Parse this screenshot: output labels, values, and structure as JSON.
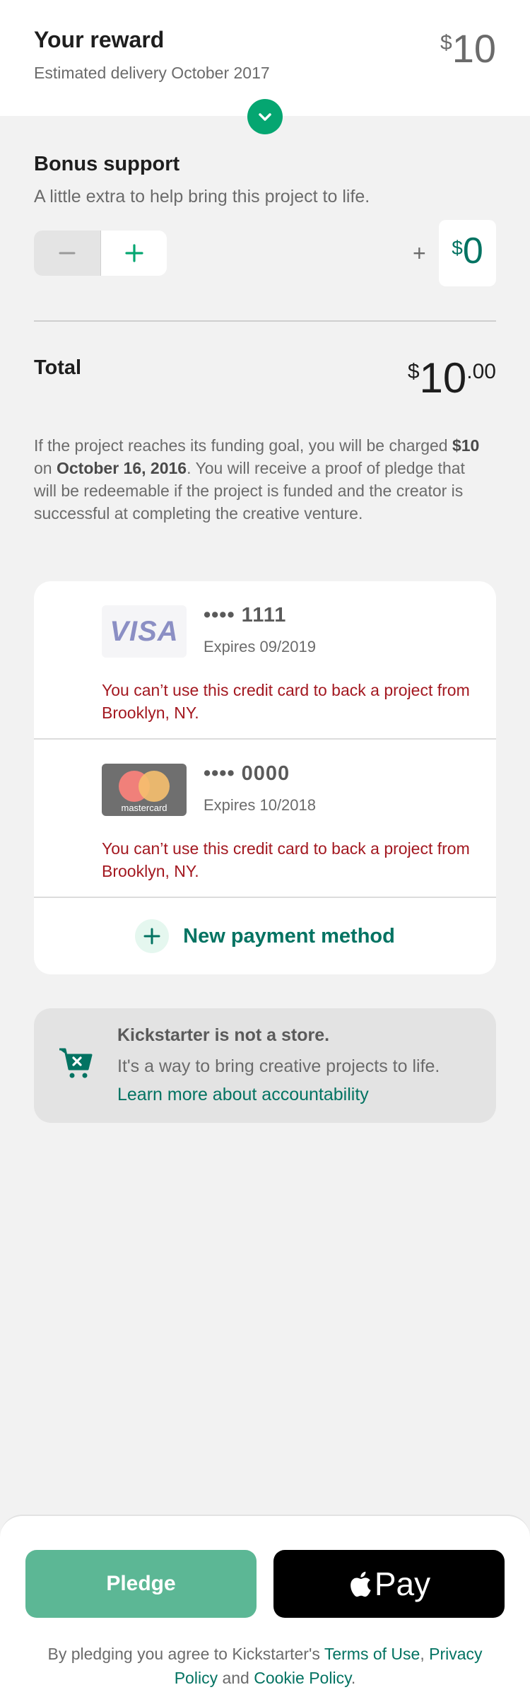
{
  "reward": {
    "title": "Your reward",
    "delivery": "Estimated delivery October 2017",
    "currency": "$",
    "amount": "10"
  },
  "bonus": {
    "title": "Bonus support",
    "subtitle": "A little extra to help bring this project to life.",
    "plus_sign": "+",
    "currency": "$",
    "value": "0"
  },
  "total": {
    "label": "Total",
    "currency": "$",
    "amount": "10",
    "cents": ".00"
  },
  "notice": {
    "part1": "If the project reaches its funding goal, you will be charged ",
    "amount": "$10",
    "part2": " on ",
    "date": "October 16, 2016",
    "part3": ". You will receive a proof of pledge that will be redeemable if the project is funded and the creator is successful at completing the creative venture."
  },
  "cards": [
    {
      "brand": "VISA",
      "number": "•••• 1111",
      "expires": "Expires 09/2019",
      "error": "You can’t use this credit card to back a project from Brooklyn, NY."
    },
    {
      "brand": "mastercard",
      "number": "•••• 0000",
      "expires": "Expires 10/2018",
      "error": "You can’t use this credit card to back a project from Brooklyn, NY."
    }
  ],
  "new_payment_label": "New payment method",
  "store_notice": {
    "title": "Kickstarter is not a store.",
    "body": "It's a way to bring creative projects to life. ",
    "link": "Learn more about accountability"
  },
  "actions": {
    "pledge_label": "Pledge",
    "applepay_label": "Pay"
  },
  "terms": {
    "prefix": "By pledging you agree to Kickstarter's ",
    "terms_link": "Terms of Use",
    "sep": ", ",
    "privacy_link": "Privacy Policy",
    "and": " and ",
    "cookie_link": "Cookie Policy",
    "end": "."
  },
  "colors": {
    "accent": "#05a671",
    "accent_dark": "#037362",
    "error": "#a31820",
    "pledge_button": "#5cb795",
    "applepay_button": "#000000"
  }
}
